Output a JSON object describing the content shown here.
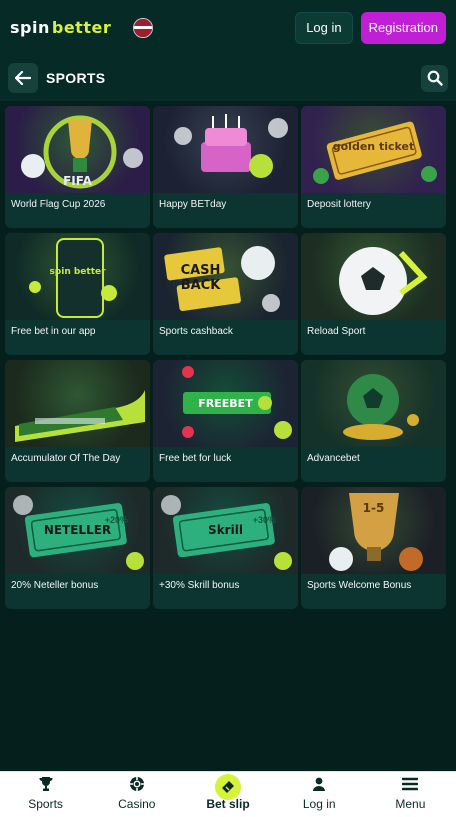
{
  "header": {
    "logo_part1": "spin",
    "logo_part2": "better",
    "login_label": "Log in",
    "register_label": "Registration",
    "flag_icon": "latvia-flag-icon"
  },
  "titlebar": {
    "title": "SPORTS",
    "back_icon": "arrow-left-icon",
    "search_icon": "search-icon"
  },
  "promos": [
    {
      "label": "World Flag Cup 2026",
      "art": "trophy-icon",
      "bg": "#2b1d47",
      "accent": "#b6e43a",
      "badge": "FIFA"
    },
    {
      "label": "Happy BETday",
      "art": "cake-icon",
      "bg": "#1c2233",
      "accent": "#e06ad6",
      "badge": ""
    },
    {
      "label": "Deposit lottery",
      "art": "golden-ticket-icon",
      "bg": "#31214f",
      "accent": "#e7b73a",
      "badge": "golden ticket"
    },
    {
      "label": "Free bet in our app",
      "art": "phone-icon",
      "bg": "#0f2a27",
      "accent": "#c7e93a",
      "badge": "spin better"
    },
    {
      "label": "Sports cashback",
      "art": "cashback-icon",
      "bg": "#1a2430",
      "accent": "#e7c83a",
      "badge": "CASH BACK"
    },
    {
      "label": "Reload Sport",
      "art": "soccer-ball-icon",
      "bg": "#1d2d22",
      "accent": "#d7f23a",
      "badge": ""
    },
    {
      "label": "Accumulator Of The Day",
      "art": "train-icon",
      "bg": "#1c2a1d",
      "accent": "#b7e13a",
      "badge": ""
    },
    {
      "label": "Free bet for luck",
      "art": "freebet-ticket-icon",
      "bg": "#1c2433",
      "accent": "#2fb24a",
      "badge": "FREEBET"
    },
    {
      "label": "Advancebet",
      "art": "soccer-ball-coins-icon",
      "bg": "#15322a",
      "accent": "#d6ad2f",
      "badge": ""
    },
    {
      "label": "20% Neteller bonus",
      "art": "neteller-ticket-icon",
      "bg": "#1e2a2a",
      "accent": "#2db07d",
      "badge": "NETELLER",
      "percent": "+20%"
    },
    {
      "label": "+30% Skrill bonus",
      "art": "skrill-ticket-icon",
      "bg": "#1e2a2a",
      "accent": "#2db07d",
      "badge": "Skrill",
      "percent": "+30%"
    },
    {
      "label": "Sports Welcome Bonus",
      "art": "trophy-cup-icon",
      "bg": "#1b1f26",
      "accent": "#d3a043",
      "badge": "1-5"
    }
  ],
  "bottom_nav": [
    {
      "label": "Sports",
      "icon": "trophy-icon"
    },
    {
      "label": "Casino",
      "icon": "chip-icon"
    },
    {
      "label": "Bet slip",
      "icon": "ticket-icon"
    },
    {
      "label": "Log in",
      "icon": "user-icon"
    },
    {
      "label": "Menu",
      "icon": "hamburger-icon"
    }
  ]
}
